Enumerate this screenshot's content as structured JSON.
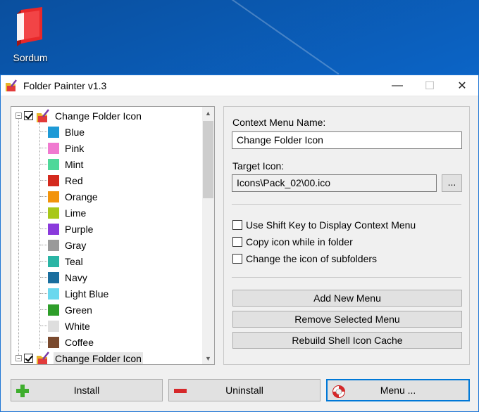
{
  "desktop": {
    "icon_label": "Sordum"
  },
  "window": {
    "title": "Folder Painter v1.3",
    "minimize": "—",
    "maximize": "☐",
    "close": "✕"
  },
  "tree": {
    "groups": [
      {
        "label": "Change Folder Icon",
        "checked": true,
        "children": [
          {
            "label": "Blue",
            "color": "#1e9ad6"
          },
          {
            "label": "Pink",
            "color": "#f07ad0"
          },
          {
            "label": "Mint",
            "color": "#4fd89a"
          },
          {
            "label": "Red",
            "color": "#d42a1e"
          },
          {
            "label": "Orange",
            "color": "#f2940c"
          },
          {
            "label": "Lime",
            "color": "#a8c81a"
          },
          {
            "label": "Purple",
            "color": "#8a3adc"
          },
          {
            "label": "Gray",
            "color": "#9a9a9a"
          },
          {
            "label": "Teal",
            "color": "#2ab5a5"
          },
          {
            "label": "Navy",
            "color": "#1a6e9e"
          },
          {
            "label": "Light Blue",
            "color": "#6ad8ee"
          },
          {
            "label": "Green",
            "color": "#2e9e2a"
          },
          {
            "label": "White",
            "color": "#dedede"
          },
          {
            "label": "Coffee",
            "color": "#7a4a2e"
          }
        ]
      },
      {
        "label": "Change Folder Icon",
        "checked": true,
        "children": []
      }
    ]
  },
  "form": {
    "context_menu_name_label": "Context Menu Name:",
    "context_menu_name_value": "Change Folder Icon",
    "target_icon_label": "Target Icon:",
    "target_icon_value": "Icons\\Pack_02\\00.ico",
    "browse_label": "...",
    "options": [
      {
        "label": "Use Shift Key to Display Context Menu",
        "checked": false
      },
      {
        "label": "Copy icon while in folder",
        "checked": false
      },
      {
        "label": "Change the icon of subfolders",
        "checked": false
      }
    ],
    "add_new_menu": "Add New Menu",
    "remove_selected_menu": "Remove Selected Menu",
    "rebuild_cache": "Rebuild Shell Icon Cache"
  },
  "footer": {
    "install": "Install",
    "uninstall": "Uninstall",
    "menu": "Menu ..."
  }
}
